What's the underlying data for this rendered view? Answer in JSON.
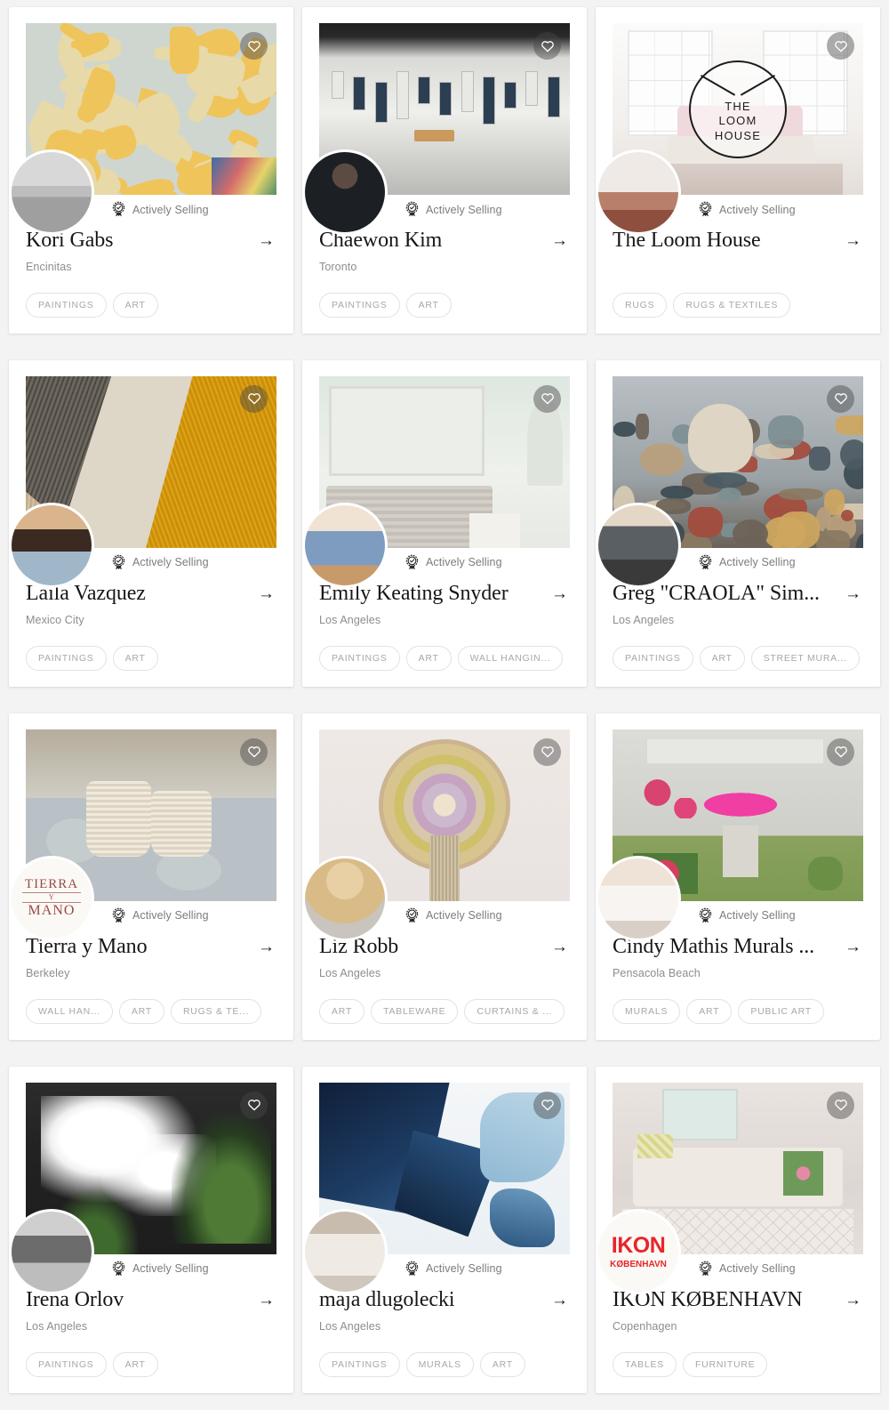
{
  "labels": {
    "verified_badge": "Actively Selling",
    "arrow_glyph": "→",
    "heart_icon_name": "heart-icon"
  },
  "cards": [
    {
      "name": "Kori Gabs",
      "location": "Encinitas",
      "status": "Actively Selling",
      "tags": [
        "PAINTINGS",
        "ART"
      ],
      "hero_style": "abstract-mural-collage",
      "avatar_style": "photo-bw-beach",
      "arrow": "→"
    },
    {
      "name": "Chaewon Kim",
      "location": "Toronto",
      "status": "Actively Selling",
      "tags": [
        "PAINTINGS",
        "ART"
      ],
      "hero_style": "gallery-interior",
      "avatar_style": "photo-woman-dark",
      "arrow": "→"
    },
    {
      "name": "The Loom House",
      "location": "",
      "status": "Actively Selling",
      "tags": [
        "RUGS",
        "RUGS & TEXTILES"
      ],
      "hero_style": "bright-bedroom",
      "avatar_style": "photo-rug-room",
      "hero_logo": {
        "line1": "THE",
        "line2": "LOOM",
        "line3": "HOUSE"
      },
      "arrow": "→"
    },
    {
      "name": "Laila Vazquez",
      "location": "Mexico City",
      "status": "Actively Selling",
      "tags": [
        "PAINTINGS",
        "ART"
      ],
      "hero_style": "textile-gold-tan",
      "avatar_style": "photo-woman-palette",
      "arrow": "→"
    },
    {
      "name": "Emily Keating Snyder",
      "location": "Los Angeles",
      "status": "Actively Selling",
      "tags": [
        "PAINTINGS",
        "ART",
        "WALL HANGIN..."
      ],
      "hero_style": "pale-bedroom-headboard",
      "avatar_style": "photo-woman-denim",
      "arrow": "→"
    },
    {
      "name": "Greg \"CRAOLA\" Sim...",
      "location": "Los Angeles",
      "status": "Actively Selling",
      "tags": [
        "PAINTINGS",
        "ART",
        "STREET MURA..."
      ],
      "hero_style": "surreal-creatures-painting",
      "avatar_style": "photo-man-studio",
      "arrow": "→"
    },
    {
      "name": "Tierra y Mano",
      "location": "Berkeley",
      "status": "Actively Selling",
      "tags": [
        "WALL HAN...",
        "ART",
        "RUGS & TE..."
      ],
      "hero_style": "woven-baskets-rug",
      "avatar_logo": {
        "kind": "tierra",
        "line1": "TIERRA",
        "line2": "Y",
        "line3": "MANO"
      },
      "arrow": "→"
    },
    {
      "name": "Liz Robb",
      "location": "Los Angeles",
      "status": "Actively Selling",
      "tags": [
        "ART",
        "TABLEWARE",
        "CURTAINS & ..."
      ],
      "hero_style": "coiled-fiber-wall-art",
      "avatar_style": "photo-woman-blonde",
      "arrow": "→"
    },
    {
      "name": "Cindy Mathis Murals ...",
      "location": "Pensacola Beach",
      "status": "Actively Selling",
      "tags": [
        "MURALS",
        "ART",
        "PUBLIC ART"
      ],
      "hero_style": "fiore-storefront-mural",
      "avatar_style": "photo-woman-painting",
      "arrow": "→"
    },
    {
      "name": "Irena Orlov",
      "location": "Los Angeles",
      "status": "Actively Selling",
      "tags": [
        "PAINTINGS",
        "ART"
      ],
      "hero_style": "white-bloom-botanical",
      "avatar_style": "photo-woman-artwork",
      "arrow": "→"
    },
    {
      "name": "maja dlugolecki",
      "location": "Los Angeles",
      "status": "Actively Selling",
      "tags": [
        "PAINTINGS",
        "MURALS",
        "ART"
      ],
      "hero_style": "blue-abstract-painting",
      "avatar_style": "photo-woman-white-robe",
      "arrow": "→"
    },
    {
      "name": "IKON KØBENHAVN",
      "location": "Copenhagen",
      "status": "Actively Selling",
      "tags": [
        "TABLES",
        "FURNITURE"
      ],
      "hero_style": "sofa-interior",
      "avatar_logo": {
        "kind": "ikon",
        "line1": "IKON",
        "line2": "KØBENHAVN"
      },
      "arrow": "→"
    }
  ],
  "colors": {
    "card_bg": "#ffffff",
    "page_bg": "#f3f3f3",
    "name_text": "#171717",
    "muted_text": "#8d8d8d",
    "tag_border": "#e2e2e2",
    "tag_text": "#a8a8a8"
  }
}
